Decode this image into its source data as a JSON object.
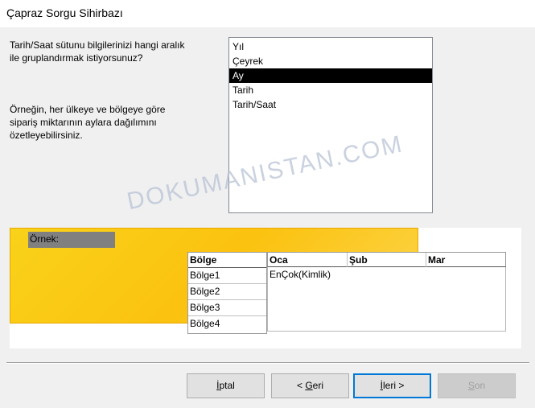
{
  "window": {
    "title": "Çapraz Sorgu Sihirbazı"
  },
  "instructions": {
    "question_line1": "Tarih/Saat sütunu bilgilerinizi hangi aralık",
    "question_line2": "ile gruplandırmak istiyorsunuz?",
    "example_line1": "Örneğin, her ülkeye ve bölgeye göre",
    "example_line2": "sipariş miktarının aylara dağılımını",
    "example_line3": "özetleyebilirsiniz."
  },
  "interval_list": {
    "items": [
      "Yıl",
      "Çeyrek",
      "Ay",
      "Tarih",
      "Tarih/Saat"
    ],
    "selected": "Ay"
  },
  "watermark": "DOKUMANISTAN.COM",
  "sample": {
    "label": "Örnek:",
    "row_header_title": "Bölge",
    "row_headers": [
      "Bölge1",
      "Bölge2",
      "Bölge3",
      "Bölge4"
    ],
    "column_headers": [
      "Oca",
      "Şub",
      "Mar"
    ],
    "value_cell": "EnÇok(Kimlik)"
  },
  "buttons": {
    "cancel": {
      "label_u": "İ",
      "label_rest": "ptal"
    },
    "back": {
      "label_pre": "< ",
      "label_u": "G",
      "label_rest": "eri"
    },
    "next": {
      "label_u": "İ",
      "label_rest": "leri >"
    },
    "finish": {
      "label_u": "S",
      "label_rest": "on"
    }
  }
}
